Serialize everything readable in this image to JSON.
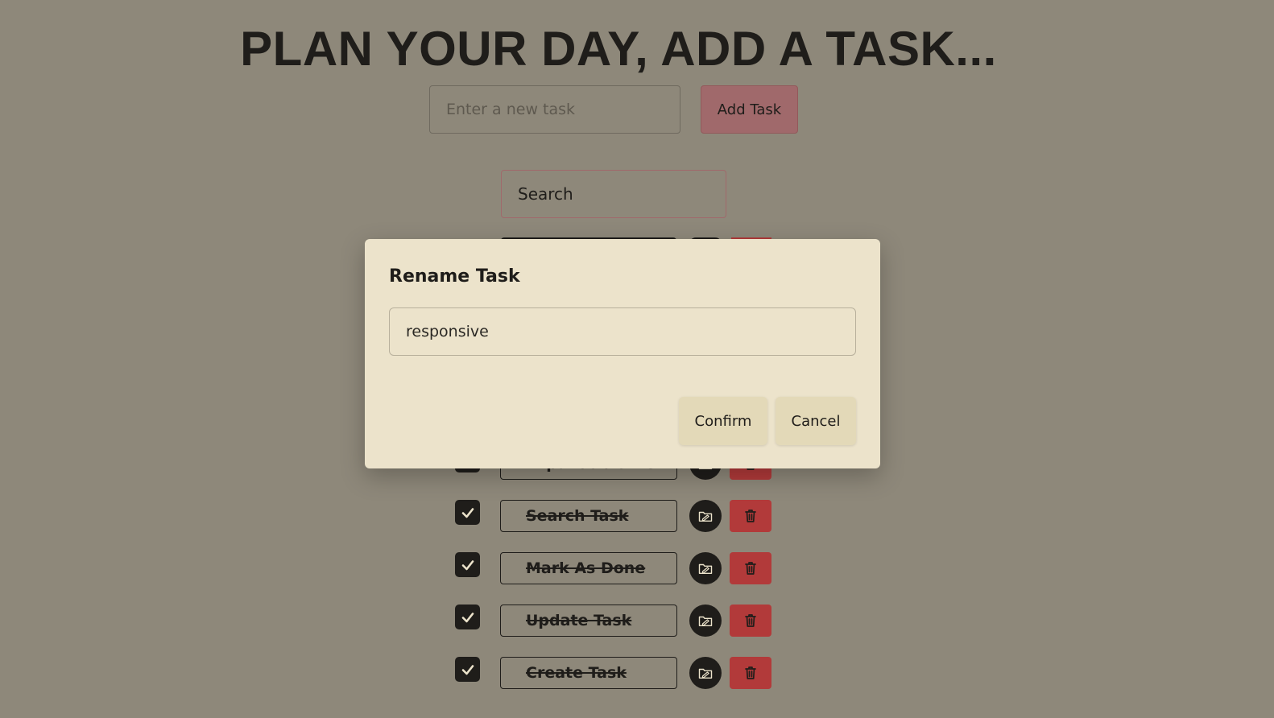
{
  "header": {
    "title": "PLAN YOUR DAY, ADD A TASK..."
  },
  "add_task": {
    "placeholder": "Enter a new task",
    "button_label": "Add Task"
  },
  "search": {
    "placeholder": "Search"
  },
  "tasks": [
    {
      "label": "Expandable List",
      "done": true
    },
    {
      "label": "Search Task",
      "done": true
    },
    {
      "label": "Mark As Done",
      "done": true
    },
    {
      "label": "Update Task",
      "done": true
    },
    {
      "label": "Create Task",
      "done": true
    }
  ],
  "modal": {
    "title": "Rename Task",
    "input_value": "responsive",
    "confirm_label": "Confirm",
    "cancel_label": "Cancel"
  },
  "colors": {
    "background": "#8e887a",
    "accent": "#a0696b",
    "delete": "#b23a3a",
    "modal_bg": "#ece3cb",
    "dark": "#1f1d1a"
  },
  "icons": {
    "check": "check-icon",
    "edit": "folder-edit-icon",
    "delete": "trash-icon"
  }
}
